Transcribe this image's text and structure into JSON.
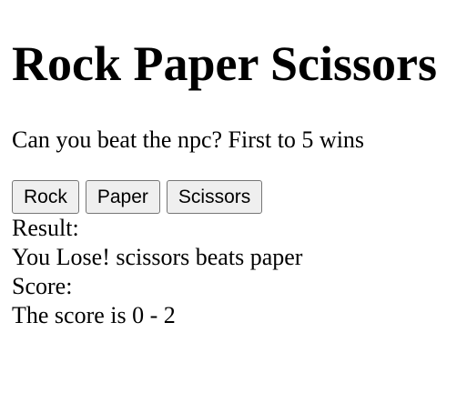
{
  "page": {
    "title": "Rock Paper Scissors",
    "subtitle": "Can you beat the npc? First to 5 wins"
  },
  "buttons": {
    "rock": "Rock",
    "paper": "Paper",
    "scissors": "Scissors"
  },
  "result": {
    "label": "Result:",
    "text": "You Lose! scissors beats paper"
  },
  "score": {
    "label": "Score:",
    "text": "The score is 0 - 2"
  }
}
